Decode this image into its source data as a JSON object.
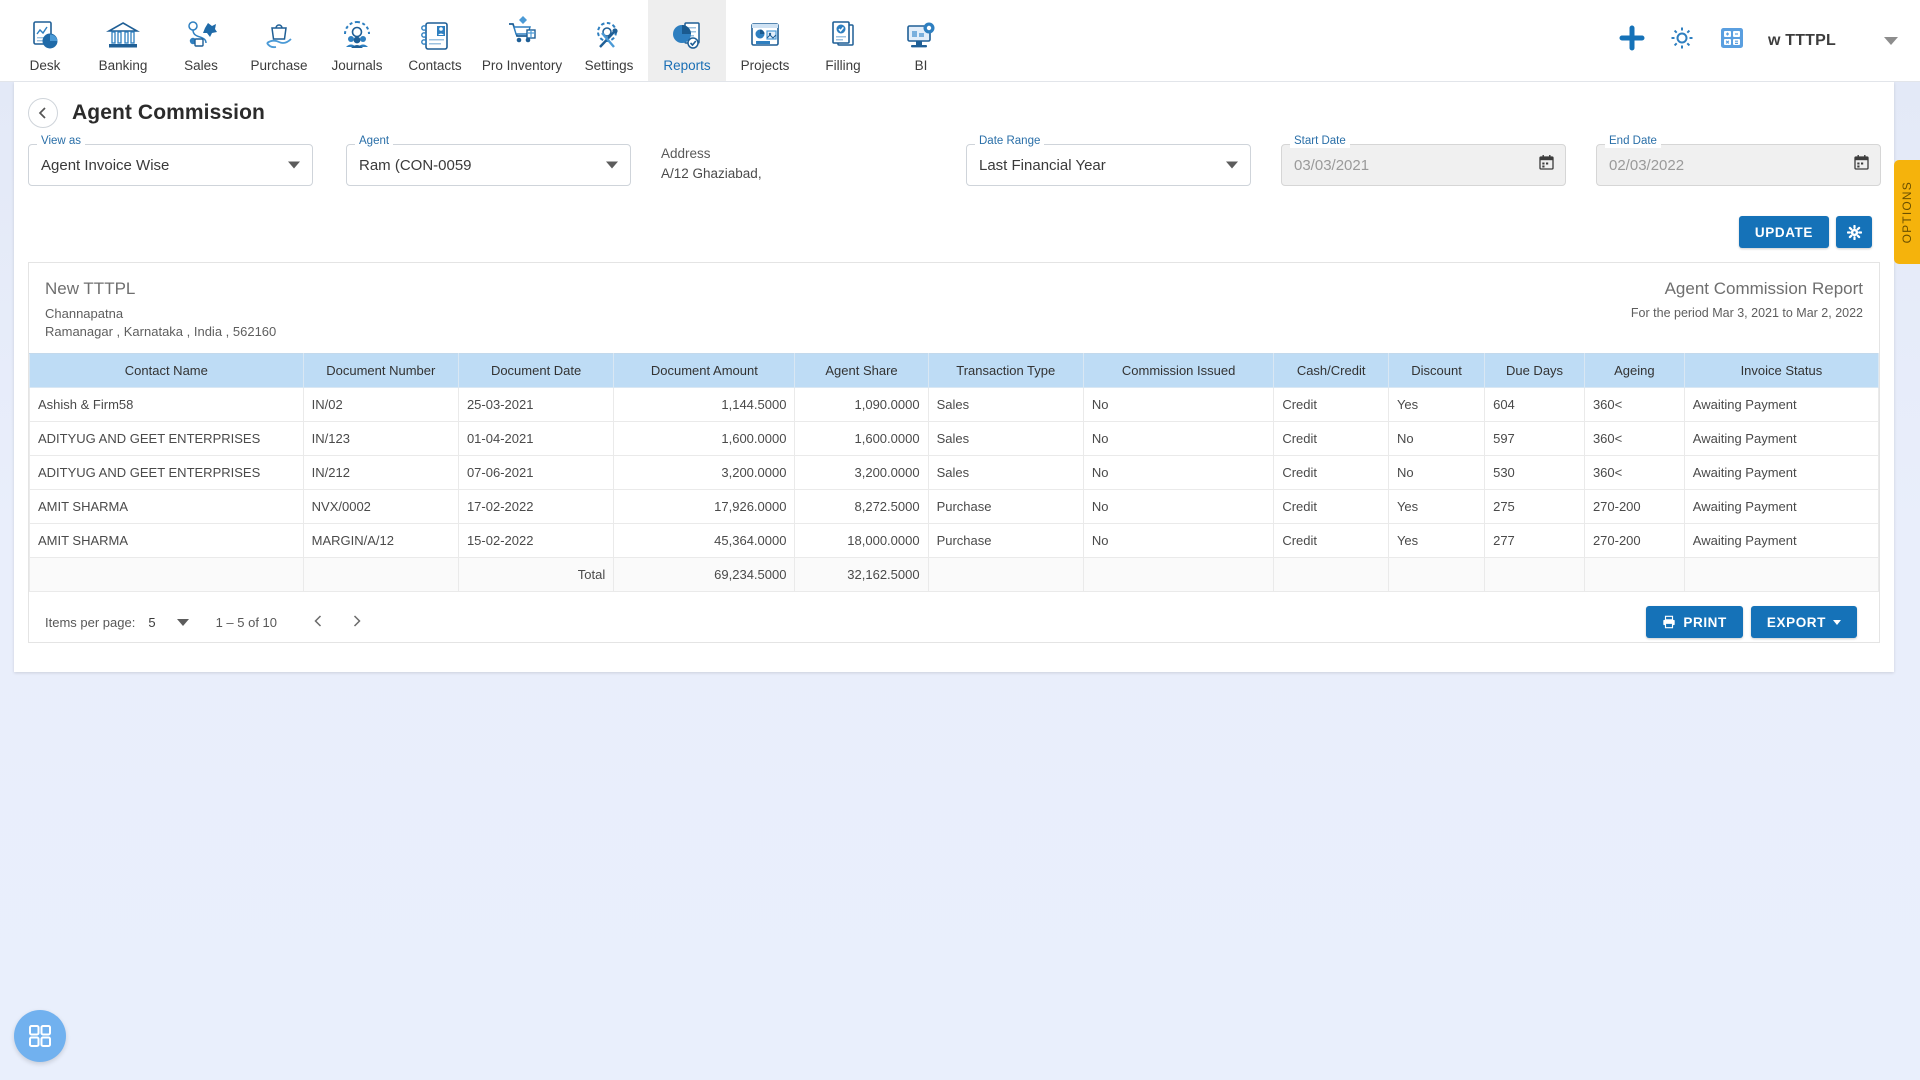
{
  "topnav": {
    "items": [
      {
        "label": "Desk",
        "icon": "desk-chart-icon"
      },
      {
        "label": "Banking",
        "icon": "bank-building-icon"
      },
      {
        "label": "Sales",
        "icon": "sales-tag-icon"
      },
      {
        "label": "Purchase",
        "icon": "purchase-bag-icon"
      },
      {
        "label": "Journals",
        "icon": "journals-gear-people-icon"
      },
      {
        "label": "Contacts",
        "icon": "contacts-book-icon"
      },
      {
        "label": "Pro Inventory",
        "icon": "inventory-cart-icon"
      },
      {
        "label": "Settings",
        "icon": "settings-tools-icon"
      },
      {
        "label": "Reports",
        "icon": "reports-piechart-icon"
      },
      {
        "label": "Projects",
        "icon": "projects-window-icon"
      },
      {
        "label": "Filling",
        "icon": "filling-documents-icon"
      },
      {
        "label": "BI",
        "icon": "bi-monitor-gear-icon"
      }
    ],
    "active": "Reports",
    "right": {
      "add_icon": "plus-icon",
      "settings_icon": "gear-icon",
      "calculator_icon": "calculator-icon",
      "company": "w TTTPL",
      "dropdown_icon": "chevron-down-icon"
    }
  },
  "header": {
    "back_icon": "chevron-left-icon",
    "title": "Agent Commission"
  },
  "filters": {
    "view_as": {
      "legend": "View as",
      "value": "Agent Invoice Wise"
    },
    "agent": {
      "legend": "Agent",
      "value": "Ram (CON-0059"
    },
    "address": {
      "label": "Address",
      "value": "A/12 Ghaziabad,"
    },
    "date_range": {
      "legend": "Date Range",
      "value": "Last Financial Year"
    },
    "start_date": {
      "legend": "Start Date",
      "value": "03/03/2021",
      "icon": "calendar-icon"
    },
    "end_date": {
      "legend": "End Date",
      "value": "02/03/2022",
      "icon": "calendar-icon"
    }
  },
  "actions": {
    "update_label": "UPDATE",
    "settings_icon": "gear-icon"
  },
  "report": {
    "company_name": "New TTTPL",
    "company_city": "Channapatna",
    "company_address": "Ramanagar , Karnataka , India , 562160",
    "title": "Agent Commission Report",
    "period": "For the period Mar 3, 2021 to Mar 2, 2022",
    "columns": [
      "Contact Name",
      "Document Number",
      "Document Date",
      "Document Amount",
      "Agent Share",
      "Transaction Type",
      "Commission Issued",
      "Cash/Credit",
      "Discount",
      "Due Days",
      "Ageing",
      "Invoice Status"
    ],
    "rows": [
      {
        "contact_name": "Ashish & Firm58",
        "document_number": "IN/02",
        "document_date": "25-03-2021",
        "document_amount": "1,144.5000",
        "agent_share": "1,090.0000",
        "transaction_type": "Sales",
        "commission_issued": "No",
        "cash_credit": "Credit",
        "discount": "Yes",
        "due_days": "604",
        "ageing": "360<",
        "invoice_status": "Awaiting Payment"
      },
      {
        "contact_name": "ADITYUG AND GEET ENTERPRISES",
        "document_number": "IN/123",
        "document_date": "01-04-2021",
        "document_amount": "1,600.0000",
        "agent_share": "1,600.0000",
        "transaction_type": "Sales",
        "commission_issued": "No",
        "cash_credit": "Credit",
        "discount": "No",
        "due_days": "597",
        "ageing": "360<",
        "invoice_status": "Awaiting Payment"
      },
      {
        "contact_name": "ADITYUG AND GEET ENTERPRISES",
        "document_number": "IN/212",
        "document_date": "07-06-2021",
        "document_amount": "3,200.0000",
        "agent_share": "3,200.0000",
        "transaction_type": "Sales",
        "commission_issued": "No",
        "cash_credit": "Credit",
        "discount": "No",
        "due_days": "530",
        "ageing": "360<",
        "invoice_status": "Awaiting Payment"
      },
      {
        "contact_name": "AMIT SHARMA",
        "document_number": "NVX/0002",
        "document_date": "17-02-2022",
        "document_amount": "17,926.0000",
        "agent_share": "8,272.5000",
        "transaction_type": "Purchase",
        "commission_issued": "No",
        "cash_credit": "Credit",
        "discount": "Yes",
        "due_days": "275",
        "ageing": "270-200",
        "invoice_status": "Awaiting Payment"
      },
      {
        "contact_name": "AMIT SHARMA",
        "document_number": "MARGIN/A/12",
        "document_date": "15-02-2022",
        "document_amount": "45,364.0000",
        "agent_share": "18,000.0000",
        "transaction_type": "Purchase",
        "commission_issued": "No",
        "cash_credit": "Credit",
        "discount": "Yes",
        "due_days": "277",
        "ageing": "270-200",
        "invoice_status": "Awaiting Payment"
      }
    ],
    "total": {
      "label": "Total",
      "document_amount": "69,234.5000",
      "agent_share": "32,162.5000"
    }
  },
  "footer": {
    "items_per_page_label": "Items per page:",
    "items_per_page_value": "5",
    "range_label": "1 – 5 of 10",
    "prev_icon": "chevron-left-icon",
    "next_icon": "chevron-right-icon",
    "print_label": "PRINT",
    "print_icon": "printer-icon",
    "export_label": "EXPORT",
    "export_caret_icon": "caret-down-icon"
  },
  "options_tab": {
    "label": "OPTIONS"
  },
  "fab": {
    "icon": "grid-apps-icon"
  },
  "colors": {
    "accent": "#1572b8",
    "nav_active_text": "#1a6fb5",
    "table_header_bg": "#bedcf5",
    "options_tab": "#f5b30c",
    "fab": "#71b1ef",
    "page_bg": "#e8eefb"
  }
}
